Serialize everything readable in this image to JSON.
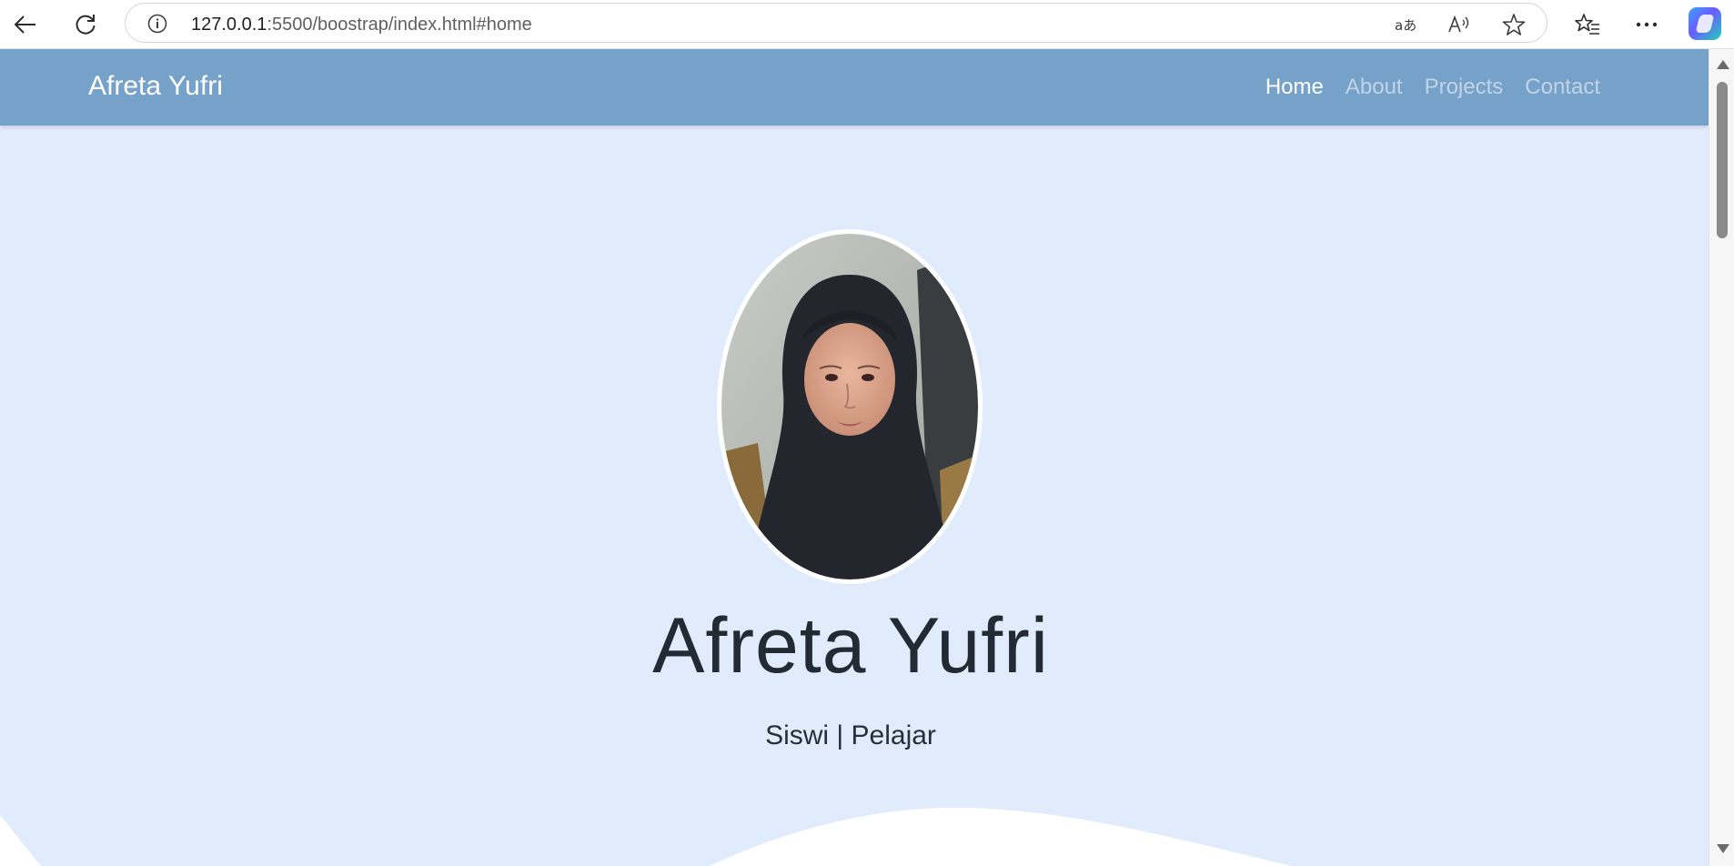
{
  "browser": {
    "url_host": "127.0.0.1",
    "url_rest": ":5500/boostrap/index.html#home",
    "icons": {
      "back": "back-arrow-icon",
      "refresh": "refresh-icon",
      "site_info": "info-icon",
      "translate": "translate-icon",
      "read_aloud": "read-aloud-icon",
      "favorite": "star-icon",
      "favorites": "favorites-icon",
      "menu": "more-icon",
      "copilot": "copilot-icon"
    }
  },
  "navbar": {
    "brand": "Afreta Yufri",
    "links": [
      "Home",
      "About",
      "Projects",
      "Contact"
    ],
    "active": "Home",
    "color": "#76a1c9"
  },
  "hero": {
    "name": "Afreta Yufri",
    "subtitle": "Siswi | Pelajar",
    "background": "#e0ebfc"
  }
}
